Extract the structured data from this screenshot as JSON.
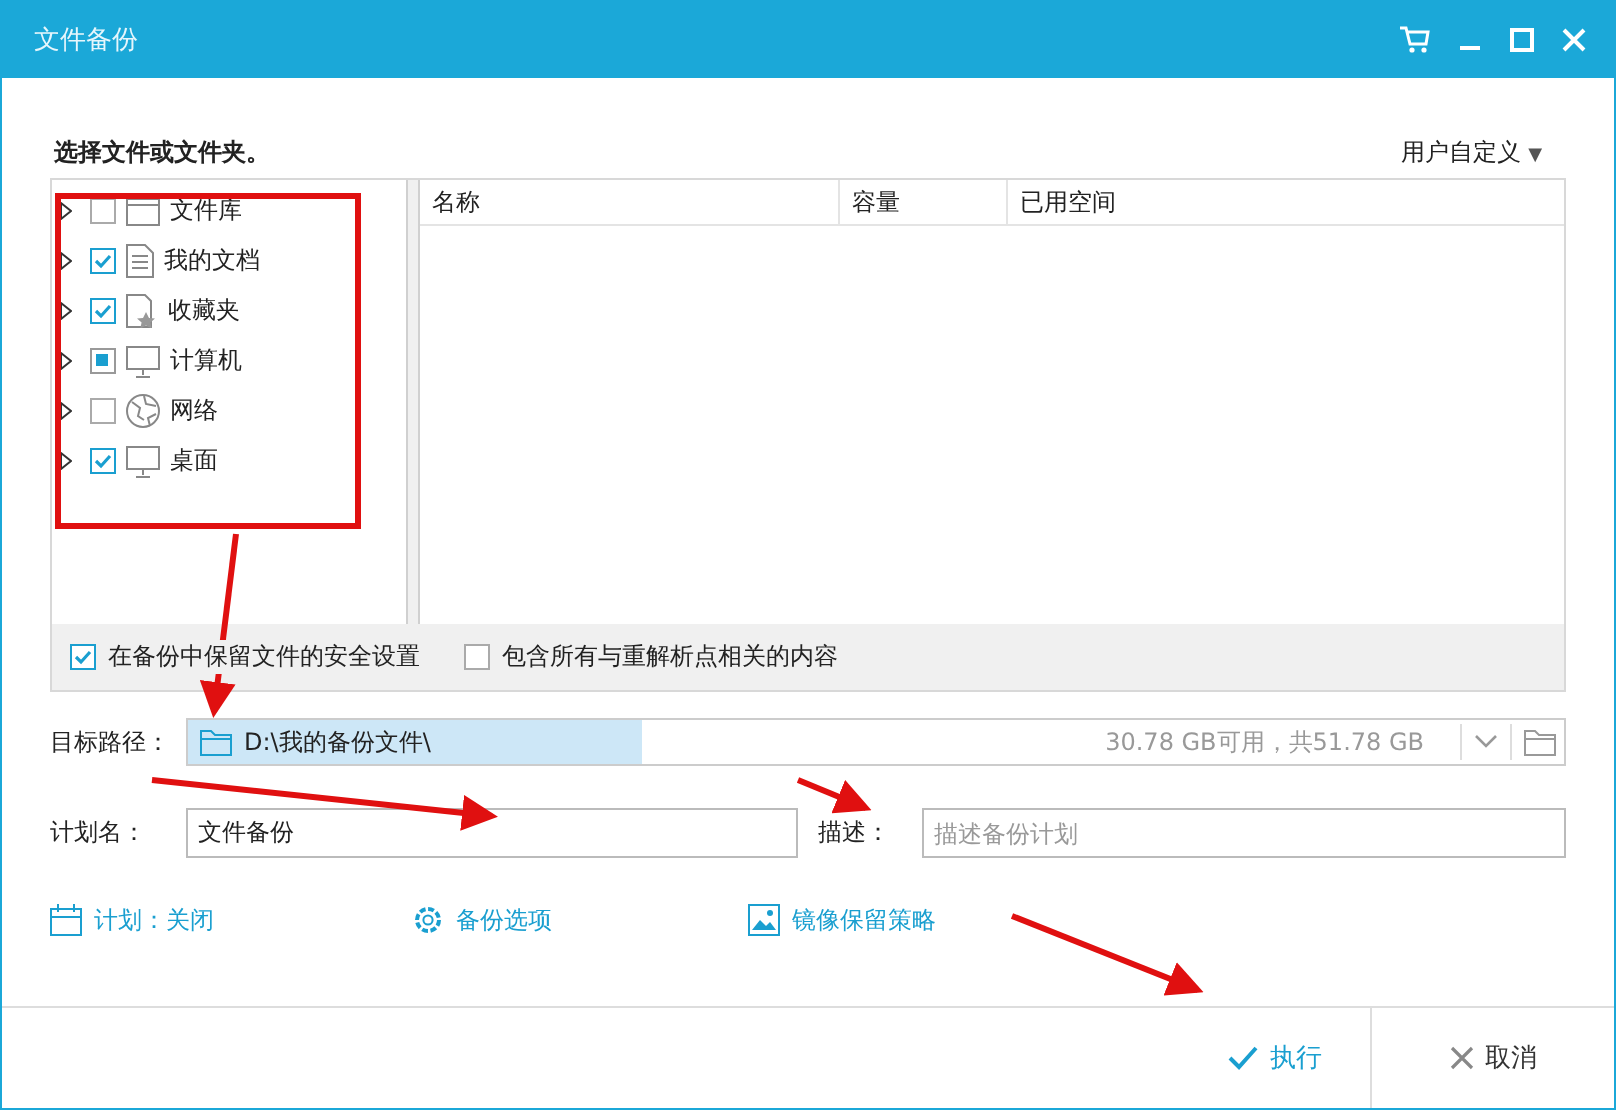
{
  "window": {
    "title": "文件备份"
  },
  "section_label": "选择文件或文件夹。",
  "view_menu": {
    "label": "用户自定义",
    "caret": "▼"
  },
  "tree": [
    {
      "label": "文件库",
      "kind": "library",
      "checked": false,
      "partial": false
    },
    {
      "label": "我的文档",
      "kind": "document",
      "checked": true,
      "partial": false
    },
    {
      "label": "收藏夹",
      "kind": "favorites",
      "checked": true,
      "partial": false
    },
    {
      "label": "计算机",
      "kind": "computer",
      "checked": false,
      "partial": true
    },
    {
      "label": "网络",
      "kind": "network",
      "checked": false,
      "partial": false
    },
    {
      "label": "桌面",
      "kind": "computer",
      "checked": true,
      "partial": false
    }
  ],
  "table": {
    "columns": [
      "名称",
      "容量",
      "已用空间"
    ]
  },
  "options": [
    {
      "label": "在备份中保留文件的安全设置",
      "checked": true
    },
    {
      "label": "包含所有与重解析点相关的内容",
      "checked": false
    }
  ],
  "target": {
    "label": "目标路径：",
    "value": "D:\\我的备份文件\\",
    "space": "30.78 GB可用，共51.78 GB",
    "level": 0.33
  },
  "plan_name": {
    "label": "计划名：",
    "value": "文件备份"
  },
  "description": {
    "label": "描述：",
    "placeholder": "描述备份计划"
  },
  "links": [
    {
      "label": "计划：关闭",
      "kind": "schedule"
    },
    {
      "label": "备份选项",
      "kind": "options"
    },
    {
      "label": "镜像保留策略",
      "kind": "image"
    }
  ],
  "buttons": [
    {
      "label": "执行",
      "kind": "ok"
    },
    {
      "label": "取消",
      "kind": "cancel"
    }
  ]
}
